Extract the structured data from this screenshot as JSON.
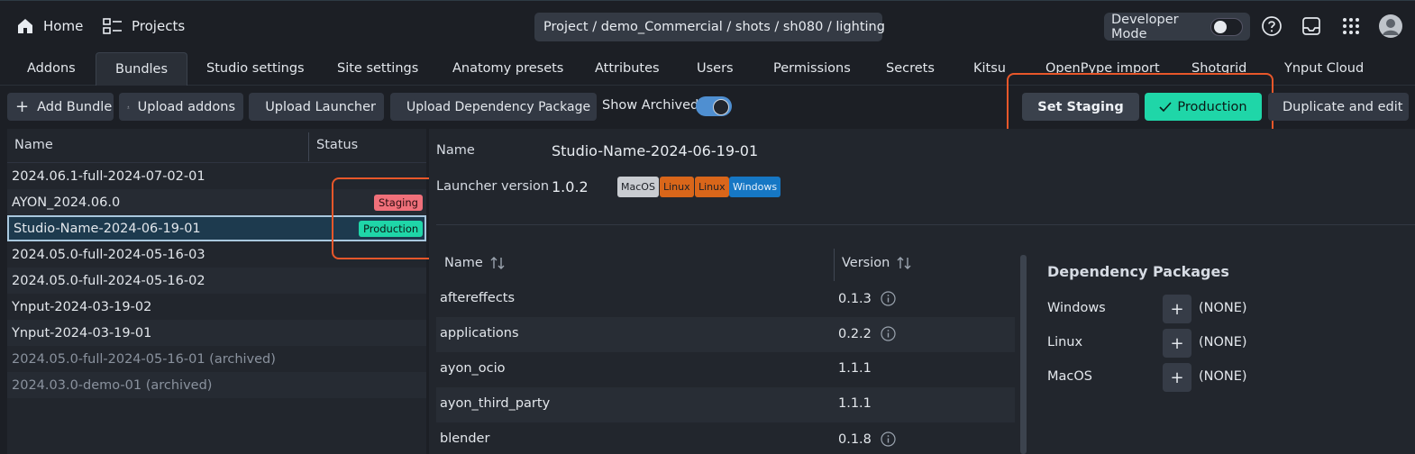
{
  "topbar": {
    "home_label": "Home",
    "projects_label": "Projects",
    "breadcrumb": "Project / demo_Commercial / shots / sh080 / lighting",
    "developer_mode_label": "Developer Mode",
    "developer_mode_on": false,
    "icons": [
      "home-icon",
      "projects-icon",
      "copy-icon",
      "help-icon",
      "inbox-icon",
      "apps-grid-icon",
      "user-avatar"
    ]
  },
  "tabs": [
    {
      "label": "Addons"
    },
    {
      "label": "Bundles",
      "active": true
    },
    {
      "label": "Studio settings"
    },
    {
      "label": "Site settings"
    },
    {
      "label": "Anatomy presets"
    },
    {
      "label": "Attributes"
    },
    {
      "label": "Users"
    },
    {
      "label": "Permissions"
    },
    {
      "label": "Secrets"
    },
    {
      "label": "Kitsu"
    },
    {
      "label": "OpenPype import"
    },
    {
      "label": "Shotgrid"
    },
    {
      "label": "Ynput Cloud"
    }
  ],
  "toolbar": {
    "add_bundle": "Add Bundle",
    "upload_addons": "Upload addons",
    "upload_launcher": "Upload Launcher",
    "upload_dependency": "Upload Dependency Package",
    "show_archived": "Show Archived",
    "show_archived_on": true,
    "set_staging": "Set Staging",
    "production": "Production",
    "duplicate_edit": "Duplicate and edit"
  },
  "bundle_list": {
    "columns": {
      "name": "Name",
      "status": "Status"
    },
    "rows": [
      {
        "name": "2024.06.1-full-2024-07-02-01",
        "status": ""
      },
      {
        "name": "AYON_2024.06.0",
        "status": "Staging"
      },
      {
        "name": "Studio-Name-2024-06-19-01",
        "status": "Production",
        "selected": true
      },
      {
        "name": "2024.05.0-full-2024-05-16-03",
        "status": ""
      },
      {
        "name": "2024.05.0-full-2024-05-16-02",
        "status": ""
      },
      {
        "name": "Ynput-2024-03-19-02",
        "status": ""
      },
      {
        "name": "Ynput-2024-03-19-01",
        "status": ""
      },
      {
        "name": "2024.05.0-full-2024-05-16-01 (archived)",
        "status": "",
        "archived": true
      },
      {
        "name": "2024.03.0-demo-01 (archived)",
        "status": "",
        "archived": true
      }
    ]
  },
  "detail": {
    "name_label": "Name",
    "name_value": "Studio-Name-2024-06-19-01",
    "launcher_label": "Launcher version",
    "launcher_value": "1.0.2",
    "platforms": [
      {
        "label": "MacOS",
        "color": "#c9ccd1"
      },
      {
        "label": "Linux",
        "color": "#d9661a"
      },
      {
        "label": "Linux",
        "color": "#d9661a"
      },
      {
        "label": "Windows",
        "color": "#1677c4"
      }
    ],
    "addons_columns": {
      "name": "Name",
      "version": "Version"
    },
    "addons": [
      {
        "name": "aftereffects",
        "version": "0.1.3",
        "info": true
      },
      {
        "name": "applications",
        "version": "0.2.2",
        "info": true
      },
      {
        "name": "ayon_ocio",
        "version": "1.1.1",
        "info": false
      },
      {
        "name": "ayon_third_party",
        "version": "1.1.1",
        "info": false
      },
      {
        "name": "blender",
        "version": "0.1.8",
        "info": true
      }
    ],
    "dependency": {
      "title": "Dependency Packages",
      "rows": [
        {
          "platform": "Windows",
          "value": "(NONE)"
        },
        {
          "platform": "Linux",
          "value": "(NONE)"
        },
        {
          "platform": "MacOS",
          "value": "(NONE)"
        }
      ]
    }
  },
  "colors": {
    "staging": "#f0707a",
    "production": "#1fd6a8",
    "highlight": "#e8572a",
    "accent": "#4f8fd1"
  }
}
